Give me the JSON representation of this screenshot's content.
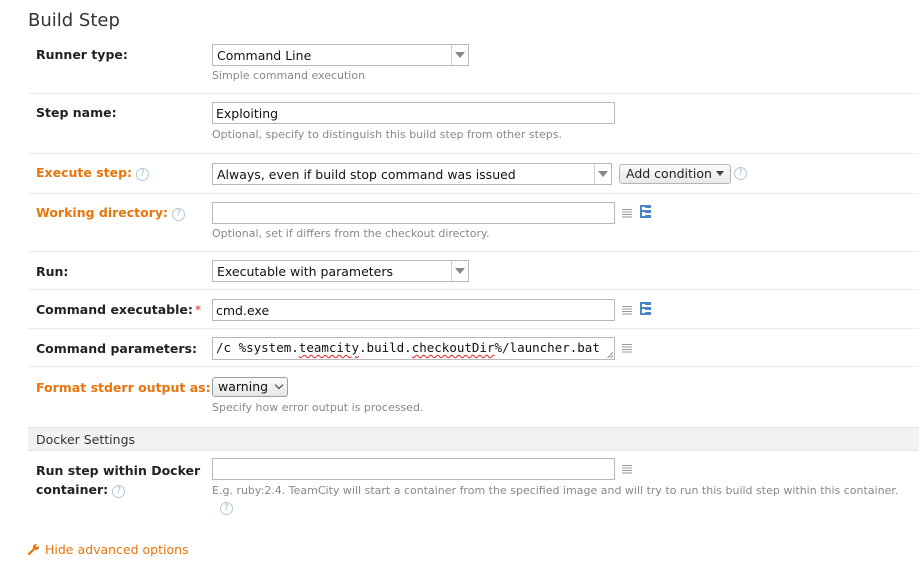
{
  "page_title": "Build Step",
  "runner_type": {
    "label": "Runner type:",
    "value": "Command Line",
    "hint": "Simple command execution"
  },
  "step_name": {
    "label": "Step name:",
    "value": "Exploiting",
    "hint": "Optional, specify to distinguish this build step from other steps."
  },
  "execute_step": {
    "label": "Execute step:",
    "help": "?",
    "value": "Always, even if build stop command was issued",
    "add_condition": "Add condition",
    "help2": "?"
  },
  "working_directory": {
    "label": "Working directory:",
    "help": "?",
    "value": "",
    "hint": "Optional, set if differs from the checkout directory."
  },
  "run": {
    "label": "Run:",
    "value": "Executable with parameters"
  },
  "command_executable": {
    "label": "Command executable:",
    "required": "*",
    "value": "cmd.exe"
  },
  "command_parameters": {
    "label": "Command parameters:",
    "value_prefix": "/c %system.",
    "value_teamcity": "teamcity",
    "value_mid": ".build.",
    "value_checkout": "checkoutDir",
    "value_suffix": "%/launcher.bat"
  },
  "format_stderr": {
    "label": "Format stderr output as:",
    "value": "warning",
    "hint": "Specify how error output is processed."
  },
  "docker": {
    "section_title": "Docker Settings",
    "label_line1": "Run step within Docker",
    "label_line2": "container:",
    "help": "?",
    "value": "",
    "hint": "E.g. ruby:2.4. TeamCity will start a container from the specified image and will try to run this build step within this container.",
    "help2": "?"
  },
  "advanced_link": "Hide advanced options",
  "icons": {
    "text_expand": "text-field-expand-icon",
    "tree_picker": "directory-tree-picker-icon",
    "help": "help-circle-icon",
    "wrench": "wrench-icon"
  },
  "colors": {
    "accent_orange": "#e8740c",
    "link_blue": "#4a86c7"
  }
}
